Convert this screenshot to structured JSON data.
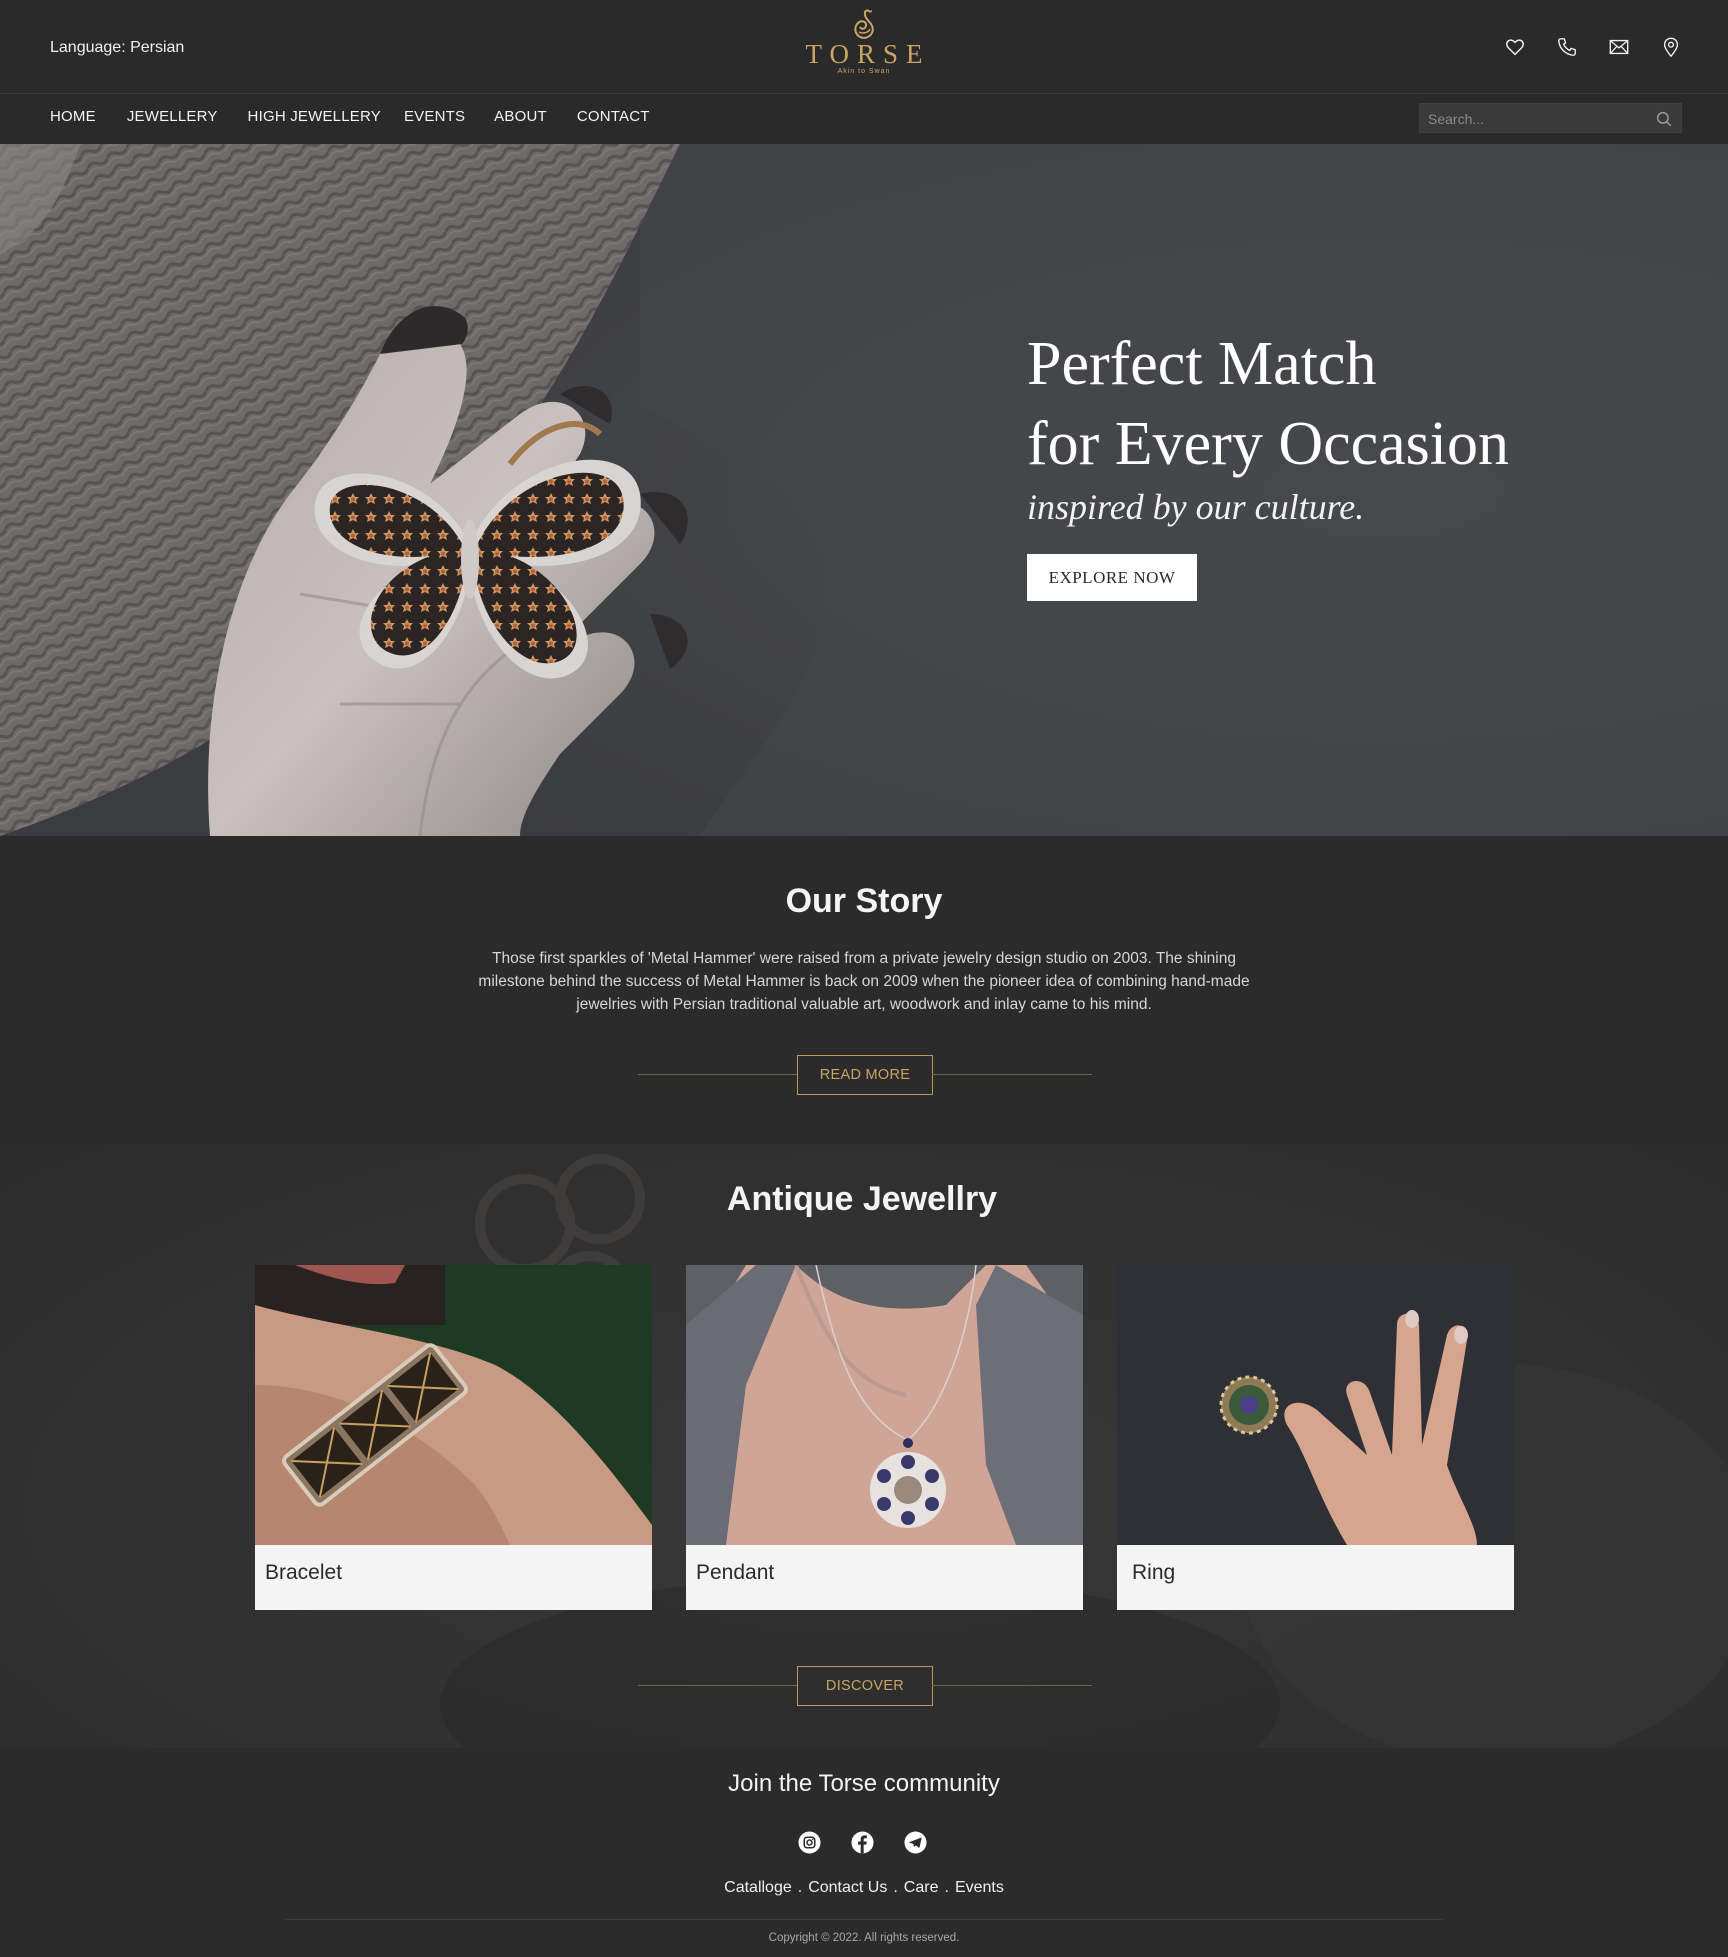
{
  "header": {
    "language_label": "Language: Persian",
    "logo_text": "TORSE",
    "logo_tagline": "Akin to Swan"
  },
  "icons": {
    "wishlist": "heart-icon",
    "call": "phone-icon",
    "mail": "mail-icon",
    "location": "location-pin-icon",
    "search": "search-icon"
  },
  "nav": {
    "items": [
      "HOME",
      "JEWELLERY",
      "HIGH JEWELLERY",
      "EVENTS",
      "ABOUT",
      "CONTACT"
    ],
    "search_placeholder": "Search..."
  },
  "hero": {
    "title_line1": "Perfect Match",
    "title_line2": "for Every Occasion",
    "subtitle": "inspired by our culture.",
    "button": "EXPLORE NOW"
  },
  "story": {
    "heading": "Our Story",
    "body": "Those first sparkles of 'Metal Hammer' were raised from a private jewelry design studio on 2003. The shining milestone behind the success of Metal Hammer is back on 2009 when the pioneer idea of combining hand-made jewelries with Persian traditional valuable art, woodwork and inlay came to his mind.",
    "button": "READ MORE"
  },
  "antique": {
    "heading": "Antique Jewellry",
    "cards": [
      {
        "label": "Bracelet"
      },
      {
        "label": "Pendant"
      },
      {
        "label": "Ring"
      }
    ],
    "button": "DISCOVER"
  },
  "footer": {
    "heading": "Join the Torse community",
    "social": [
      "instagram-icon",
      "facebook-icon",
      "telegram-icon"
    ],
    "links": [
      "Catalloge",
      "Contact Us",
      "Care",
      "Events"
    ],
    "separator": ".",
    "copyright": "Copyright © 2022. All rights reserved."
  },
  "colors": {
    "background": "#2b2b2b",
    "accent_gold": "#c9a466",
    "text": "#f2f2f2"
  }
}
